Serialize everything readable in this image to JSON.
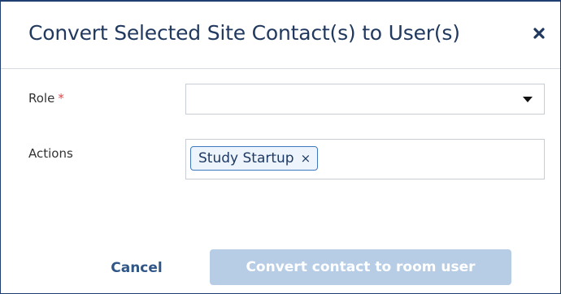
{
  "dialog": {
    "title": "Convert Selected Site Contact(s) to User(s)",
    "close_icon": "close-icon"
  },
  "form": {
    "role": {
      "label": "Role",
      "required_marker": "*",
      "value": ""
    },
    "actions": {
      "label": "Actions",
      "tags": [
        {
          "label": "Study Startup",
          "remove_glyph": "×"
        }
      ]
    }
  },
  "footer": {
    "cancel_label": "Cancel",
    "convert_label": "Convert contact to room user",
    "convert_enabled": false
  },
  "colors": {
    "title": "#21395e",
    "border": "#1f3f73",
    "required": "#e0474c",
    "tag_border": "#3f79bd",
    "cancel": "#2f5686",
    "convert_disabled_bg": "#b7cde6"
  }
}
